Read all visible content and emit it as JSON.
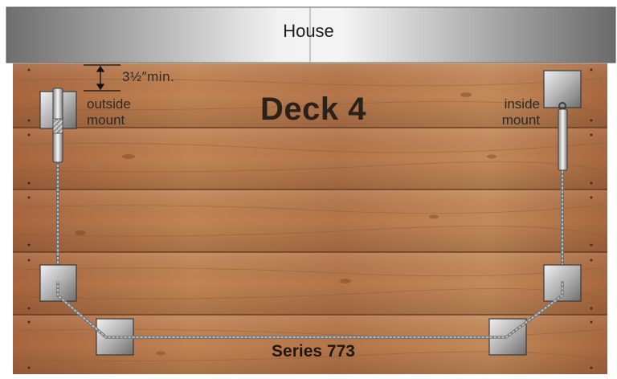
{
  "house": {
    "label": "House"
  },
  "deck": {
    "title": "Deck 4"
  },
  "dimension": {
    "label": "3½″min."
  },
  "mounts": {
    "outside": {
      "line1": "outside",
      "line2": "mount"
    },
    "inside": {
      "line1": "inside",
      "line2": "mount"
    }
  },
  "series": {
    "label": "Series 773"
  },
  "colors": {
    "wood_base": "#b0714a",
    "wood_dark": "#7e4a2c",
    "wood_light": "#c98a5c",
    "house_gray": "#8e8e8e",
    "metal_plate": "#9d9d9d",
    "cable": "#8a8a8a"
  }
}
